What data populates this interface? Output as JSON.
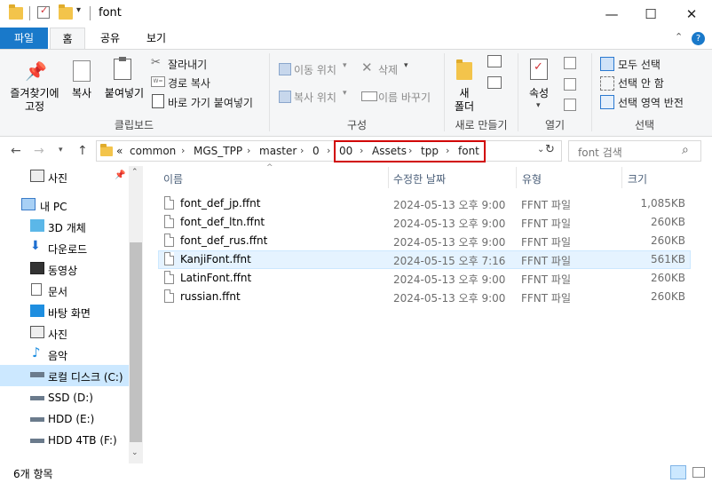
{
  "window": {
    "title": "font"
  },
  "ribbon_tabs": {
    "file": "파일",
    "home": "홈",
    "share": "공유",
    "view": "보기"
  },
  "ribbon": {
    "clipboard": {
      "pin": "즐겨찾기에\n고정",
      "copy": "복사",
      "paste": "붙여넣기",
      "cut": "잘라내기",
      "copy_path": "경로 복사",
      "paste_shortcut": "바로 가기 붙여넣기",
      "label": "클립보드"
    },
    "organize": {
      "move_to": "이동 위치",
      "copy_to": "복사 위치",
      "delete": "삭제",
      "rename": "이름 바꾸기",
      "label": "구성"
    },
    "new": {
      "new_folder": "새\n폴더",
      "label": "새로 만들기"
    },
    "open": {
      "properties": "속성",
      "label": "열기"
    },
    "select": {
      "select_all": "모두 선택",
      "select_none": "선택 안 함",
      "invert": "선택 영역 반전",
      "label": "선택"
    }
  },
  "address": {
    "overflow": "«",
    "crumbs": [
      "common",
      "MGS_TPP",
      "master",
      "0",
      "00",
      "Assets",
      "tpp",
      "font"
    ]
  },
  "search": {
    "placeholder": "font 검색"
  },
  "nav": {
    "items": [
      {
        "label": "사진",
        "icon": "pictures-icon"
      },
      {
        "label": "내 PC",
        "icon": "pc-icon"
      },
      {
        "label": "3D 개체",
        "icon": "3d-objects-icon"
      },
      {
        "label": "다운로드",
        "icon": "download-icon"
      },
      {
        "label": "동영상",
        "icon": "video-icon"
      },
      {
        "label": "문서",
        "icon": "document-icon"
      },
      {
        "label": "바탕 화면",
        "icon": "desktop-icon"
      },
      {
        "label": "사진",
        "icon": "pictures-icon"
      },
      {
        "label": "음악",
        "icon": "music-icon"
      },
      {
        "label": "로컬 디스크 (C:)",
        "icon": "drive-icon"
      },
      {
        "label": "SSD (D:)",
        "icon": "drive-icon"
      },
      {
        "label": "HDD (E:)",
        "icon": "drive-icon"
      },
      {
        "label": "HDD 4TB (F:)",
        "icon": "drive-icon"
      }
    ]
  },
  "columns": {
    "name": "이름",
    "date": "수정한 날짜",
    "type": "유형",
    "size": "크기"
  },
  "files": [
    {
      "name": "font_def_jp.ffnt",
      "date": "2024-05-13 오후 9:00",
      "type": "FFNT 파일",
      "size": "1,085KB"
    },
    {
      "name": "font_def_ltn.ffnt",
      "date": "2024-05-13 오후 9:00",
      "type": "FFNT 파일",
      "size": "260KB"
    },
    {
      "name": "font_def_rus.ffnt",
      "date": "2024-05-13 오후 9:00",
      "type": "FFNT 파일",
      "size": "260KB"
    },
    {
      "name": "KanjiFont.ffnt",
      "date": "2024-05-15 오후 7:16",
      "type": "FFNT 파일",
      "size": "561KB"
    },
    {
      "name": "LatinFont.ffnt",
      "date": "2024-05-13 오후 9:00",
      "type": "FFNT 파일",
      "size": "260KB"
    },
    {
      "name": "russian.ffnt",
      "date": "2024-05-13 오후 9:00",
      "type": "FFNT 파일",
      "size": "260KB"
    }
  ],
  "status": {
    "count": "6개 항목"
  },
  "colors": {
    "accent": "#1979ca",
    "highlight_border": "#d10000",
    "selected_row": "#e5f3ff"
  }
}
